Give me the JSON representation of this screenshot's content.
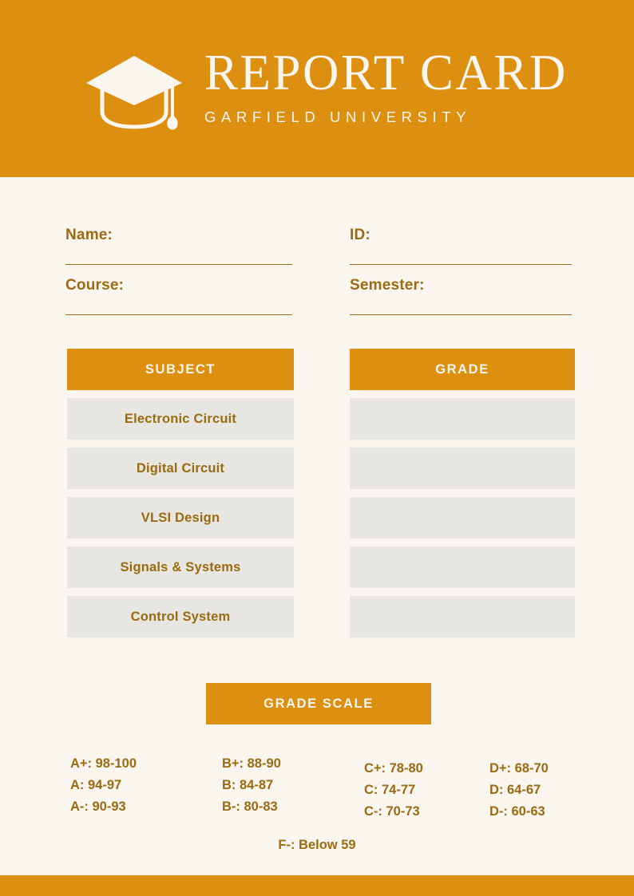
{
  "header": {
    "title": "REPORT CARD",
    "university": "GARFIELD UNIVERSITY",
    "icon": "graduation-cap-icon",
    "background_color": "#dd9010",
    "text_color": "#faf5ee"
  },
  "page": {
    "background_color": "#faf5ee",
    "accent_color": "#dd9010",
    "label_color": "#9a6b10",
    "cell_color": "#e7e6e0"
  },
  "fields": [
    {
      "label": "Name:",
      "value": ""
    },
    {
      "label": "ID:",
      "value": ""
    },
    {
      "label": "Course:",
      "value": ""
    },
    {
      "label": "Semester:",
      "value": ""
    }
  ],
  "table": {
    "columns": [
      "SUBJECT",
      "GRADE"
    ],
    "rows": [
      {
        "subject": "Electronic Circuit",
        "grade": ""
      },
      {
        "subject": "Digital Circuit",
        "grade": ""
      },
      {
        "subject": "VLSI Design",
        "grade": ""
      },
      {
        "subject": "Signals & Systems",
        "grade": ""
      },
      {
        "subject": "Control System",
        "grade": ""
      }
    ]
  },
  "grade_scale": {
    "heading": "GRADE SCALE",
    "columns": [
      [
        "A+: 98-100",
        "A: 94-97",
        "A-: 90-93"
      ],
      [
        "B+: 88-90",
        "B: 84-87",
        "B-: 80-83"
      ],
      [
        "C+: 78-80",
        "C: 74-77",
        "C-: 70-73"
      ],
      [
        "D+: 68-70",
        "D: 64-67",
        "D-: 60-63"
      ]
    ],
    "failing": "F-: Below 59"
  }
}
